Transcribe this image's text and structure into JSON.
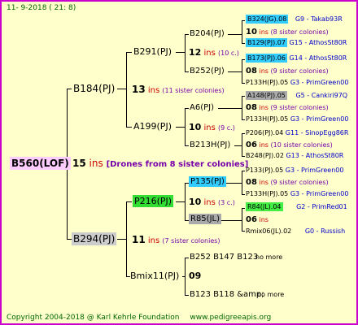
{
  "header": {
    "date": "11-  9-2018 ( 21:  8)"
  },
  "root": {
    "name": "B560(LOF)",
    "count": "15",
    "ins": "ins",
    "note": "[Drones from 8 sister colonies]"
  },
  "gen1": [
    {
      "name": "B184(PJ)",
      "count": "13",
      "ins": "ins",
      "note": "(11 sister colonies)"
    },
    {
      "name": "B294(PJ)",
      "count": "11",
      "ins": "ins",
      "note": "(7 sister colonies)"
    }
  ],
  "gen2": [
    {
      "name": "B291(PJ)",
      "count": "12",
      "ins": "ins",
      "note": "(10 c.)"
    },
    {
      "name": "A199(PJ)",
      "count": "10",
      "ins": "ins",
      "note": "(9 c.)"
    },
    {
      "name": "P216(PJ)",
      "count": "10",
      "ins": "ins",
      "note": "(3 c.)"
    },
    {
      "name": "Bmix11(PJ)",
      "count": "09"
    }
  ],
  "gen3": [
    {
      "name": "B204(PJ)"
    },
    {
      "name": "B252(PJ)"
    },
    {
      "name": "A6(PJ)"
    },
    {
      "name": "B213H(PJ)"
    },
    {
      "name": "P135(PJ)"
    },
    {
      "name": "R85(JL)"
    },
    {
      "name": "B252 B147 B123",
      "more": "no more"
    },
    {
      "name": "B123 B118 &amp;",
      "more": "no more"
    }
  ],
  "gen4": [
    {
      "name": "B324(JG).08",
      "info": "G9 - Takab93R"
    },
    {
      "count": "10",
      "ins": "ins",
      "note": "(8 sister colonies)"
    },
    {
      "name": "B129(PJ).07",
      "info": "G15 - AthosSt80R"
    },
    {
      "name": "B173(PJ).06",
      "info": "G14 - AthosSt80R"
    },
    {
      "count": "08",
      "ins": "ins",
      "note": "(9 sister colonies)"
    },
    {
      "name": "P133H(PJ).05",
      "info": "G3 - PrimGreen00"
    },
    {
      "name": "A148(PJ).05",
      "info": "G5 - Cankiri97Q"
    },
    {
      "count": "08",
      "ins": "ins",
      "note": "(9 sister colonies)"
    },
    {
      "name": "P133H(PJ).05",
      "info": "G3 - PrimGreen00"
    },
    {
      "name": "P206(PJ).04",
      "info": "G11 - SinopEgg86R"
    },
    {
      "count": "06",
      "ins": "ins",
      "note": "(10 sister colonies)"
    },
    {
      "name": "B248(PJ).02",
      "info": "G13 - AthosSt80R"
    },
    {
      "name": "P133(PJ).05",
      "info": "G3 - PrimGreen00"
    },
    {
      "count": "08",
      "ins": "ins",
      "note": "(9 sister colonies)"
    },
    {
      "name": "P133H(PJ).05",
      "info": "G3 - PrimGreen00"
    },
    {
      "name": "R84(JL).04",
      "info": "G2 - PrimRed01"
    },
    {
      "count": "06",
      "ins": "ins"
    },
    {
      "name": "Rmix06(JL).02",
      "info": "G0 - Russish"
    }
  ],
  "footer": {
    "copyright": "Copyright 2004-2018 @ Karl Kehrle Foundation",
    "site": "www.pedigreeapis.org"
  }
}
